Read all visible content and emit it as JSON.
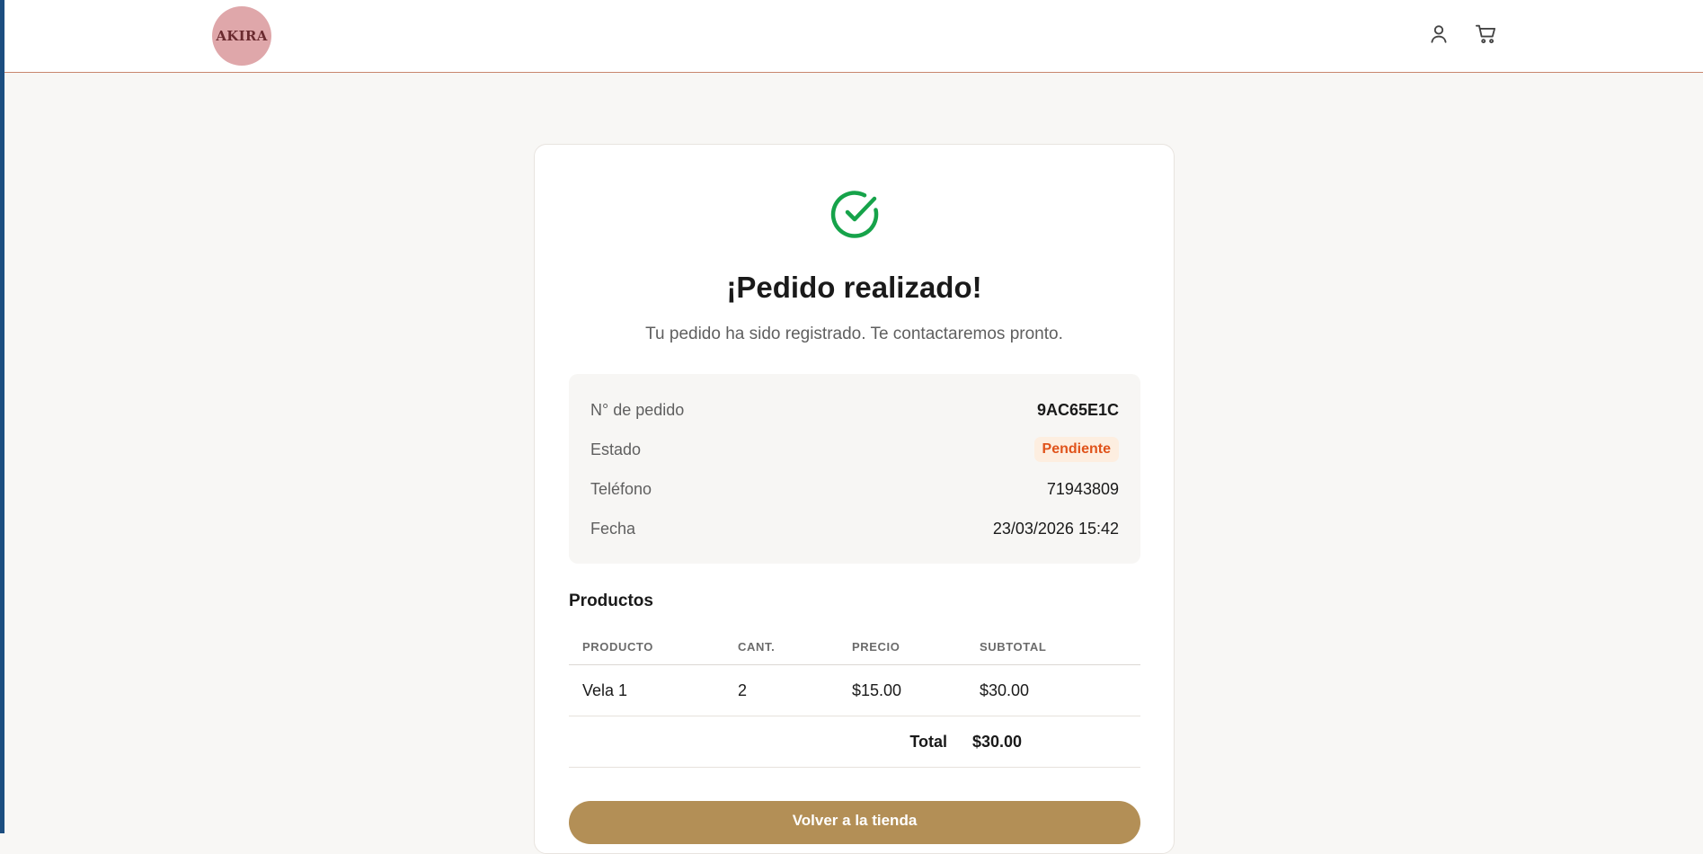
{
  "header": {
    "logo_text": "AKIRA",
    "icons": [
      "user-icon",
      "cart-icon"
    ]
  },
  "confirmation": {
    "icon": "check-circle-icon",
    "title": "¡Pedido realizado!",
    "subtitle": "Tu pedido ha sido registrado. Te contactaremos pronto.",
    "colors": {
      "success": "#16a34a",
      "badge_bg": "#fdeee0",
      "badge_text": "#e0531a",
      "button": "#b38f56"
    }
  },
  "order": {
    "number_label": "N° de pedido",
    "number_value": "9AC65E1C",
    "status_label": "Estado",
    "status_value": "Pendiente",
    "phone_label": "Teléfono",
    "phone_value": "71943809",
    "date_label": "Fecha",
    "date_value": "23/03/2026 15:42"
  },
  "products": {
    "section_title": "Productos",
    "columns": [
      "PRODUCTO",
      "CANT.",
      "PRECIO",
      "SUBTOTAL"
    ],
    "rows": [
      {
        "product": "Vela 1",
        "qty": "2",
        "price": "$15.00",
        "subtotal": "$30.00"
      }
    ],
    "total_label": "Total",
    "total_value": "$30.00"
  },
  "actions": {
    "back_label": "Volver a la tienda"
  }
}
